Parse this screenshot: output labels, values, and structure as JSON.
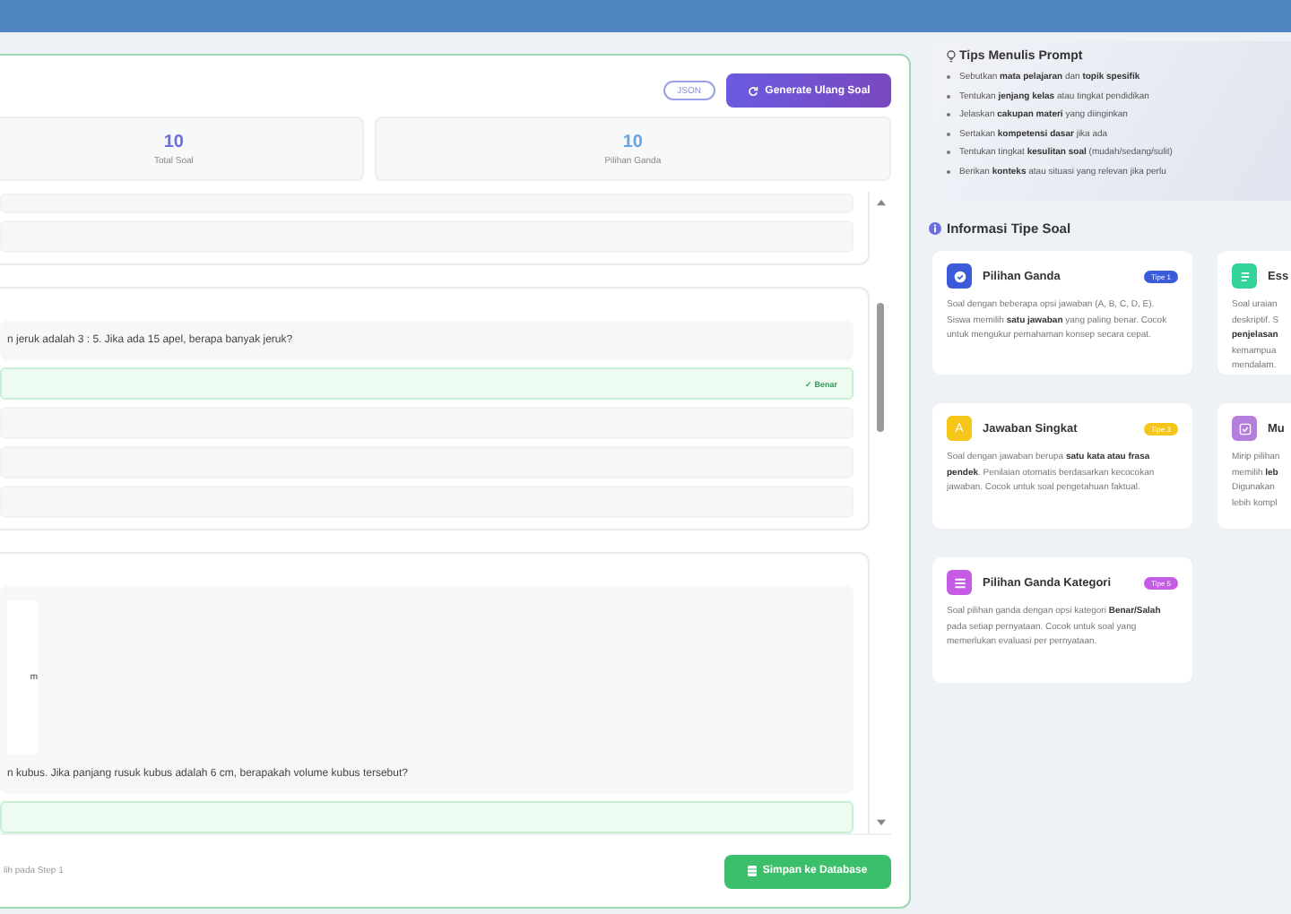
{
  "toolbar": {
    "json_button": "JSON",
    "generate_button": "Generate Ulang Soal"
  },
  "stats": [
    {
      "value": "10",
      "label": "Total Soal"
    },
    {
      "value": "10",
      "label": "Pilihan Ganda"
    }
  ],
  "questions": [
    {
      "options": [
        {
          "correct": false
        },
        {
          "correct": false
        }
      ]
    },
    {
      "question": "n jeruk adalah 3 : 5. Jika ada 15 apel, berapa banyak jeruk?",
      "options": [
        {
          "correct": true,
          "badge": "✓ Benar"
        },
        {
          "correct": false
        },
        {
          "correct": false
        },
        {
          "correct": false
        }
      ]
    },
    {
      "figure_label": "m",
      "question": "n kubus. Jika panjang rusuk kubus adalah 6 cm, berapakah volume kubus tersebut?",
      "options": [
        {
          "correct": true
        }
      ]
    }
  ],
  "footer": {
    "note": "lih pada Step 1",
    "save_button": "Simpan ke Database"
  },
  "tips": {
    "title": "Tips Menulis Prompt",
    "items": [
      "Sebutkan **mata pelajaran** dan **topik spesifik**",
      "Tentukan **jenjang kelas** atau tingkat pendidikan",
      "Jelaskan **cakupan materi** yang diinginkan",
      "Sertakan **kompetensi dasar** jika ada",
      "Tentukan tingkat **kesulitan soal** (mudah/sedang/sulit)",
      "Berikan **konteks** atau situasi yang relevan jika perlu"
    ]
  },
  "info": {
    "title": "Informasi Tipe Soal",
    "types": [
      {
        "kind": "check",
        "title": "Pilihan Ganda",
        "badge": "Tipe 1",
        "color": "#3b5bdb",
        "description": "Soal dengan beberapa opsi jawaban (A, B, C, D, E). Siswa memilih **satu jawaban** yang paling benar. Cocok untuk mengukur pemahaman konsep secara cepat."
      },
      {
        "kind": "lines",
        "title": "Ess",
        "color": "#34d399",
        "description_lines": [
          "Soal uraian",
          "deskriptif. S",
          "**penjelasan**",
          "kemampua",
          "mendalam."
        ]
      },
      {
        "kind": "letter",
        "icon_letter": "A",
        "title": "Jawaban Singkat",
        "badge": "Tipe 3",
        "color": "#f5c518",
        "description": "Soal dengan jawaban berupa **satu kata atau frasa pendek**. Penilaian otomatis berdasarkan kecocokan jawaban. Cocok untuk soal pengetahuan faktual."
      },
      {
        "kind": "checkbox",
        "title": "Mu",
        "color": "#b57edc",
        "description_lines": [
          "Mirip pilihan",
          "memilih **leb**",
          "Digunakan",
          "lebih kompl"
        ]
      },
      {
        "kind": "list",
        "title": "Pilihan Ganda Kategori",
        "badge": "Tipe 5",
        "color": "#c45ce6",
        "description": "Soal pilihan ganda dengan opsi kategori **Benar/Salah** pada setiap pernyataan. Cocok untuk soal yang memerlukan evaluasi per pernyataan."
      }
    ]
  }
}
